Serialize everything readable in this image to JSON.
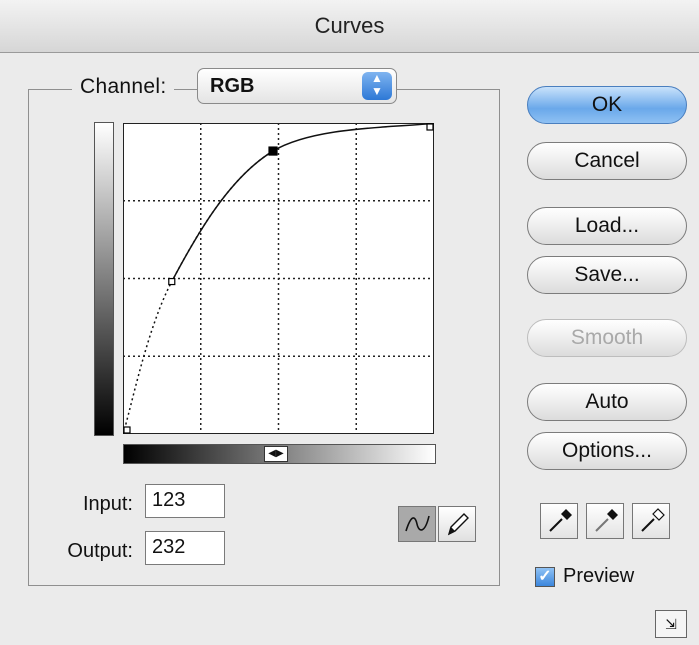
{
  "window": {
    "title": "Curves"
  },
  "channel": {
    "label": "Channel:",
    "value": "RGB"
  },
  "fields": {
    "input_label": "Input:",
    "input_value": "123",
    "output_label": "Output:",
    "output_value": "232"
  },
  "buttons": {
    "ok": "OK",
    "cancel": "Cancel",
    "load": "Load...",
    "save": "Save...",
    "smooth": "Smooth",
    "auto": "Auto",
    "options": "Options..."
  },
  "preview": {
    "label": "Preview",
    "checked": true
  },
  "curve_points": [
    {
      "input": 0,
      "output": 0
    },
    {
      "input": 40,
      "output": 125
    },
    {
      "input": 123,
      "output": 232
    },
    {
      "input": 255,
      "output": 255
    }
  ],
  "selected_point_index": 2,
  "icons": [
    "curve-tool-icon",
    "pencil-tool-icon",
    "black-eyedropper-icon",
    "gray-eyedropper-icon",
    "white-eyedropper-icon",
    "resize-icon"
  ],
  "colors": {
    "default_button": "#6aa8ea"
  }
}
